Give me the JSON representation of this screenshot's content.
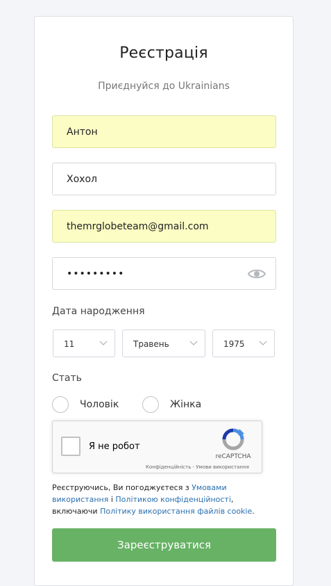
{
  "form": {
    "title": "Реєстрація",
    "subtitle": "Приєднуйся до Ukrainians",
    "first_name": "Антон",
    "last_name": "Хохол",
    "email": "themrglobeteam@gmail.com",
    "password": "•••••••••",
    "password_toggle_icon": "eye-icon"
  },
  "birthdate": {
    "label": "Дата народження",
    "day": "11",
    "month": "Травень",
    "year": "1975"
  },
  "gender": {
    "label": "Стать",
    "male": "Чоловік",
    "female": "Жінка"
  },
  "captcha": {
    "label": "Я не робот",
    "brand": "reCAPTCHA",
    "terms": "Конфіденційність - Умови використання"
  },
  "legal": {
    "part1": "Реєструючись, Ви погоджуєтеся з ",
    "link_terms": "Умовами використання",
    "part2": " і ",
    "link_privacy": "Політикою конфіденційності",
    "part3": ", включаючи ",
    "link_cookie": "Політику використання файлів cookie",
    "part4": "."
  },
  "submit_label": "Зареєструватися",
  "colors": {
    "accent_green": "#67b265",
    "link_blue": "#2a6fb0",
    "autofill_yellow": "#fbfdc4"
  }
}
